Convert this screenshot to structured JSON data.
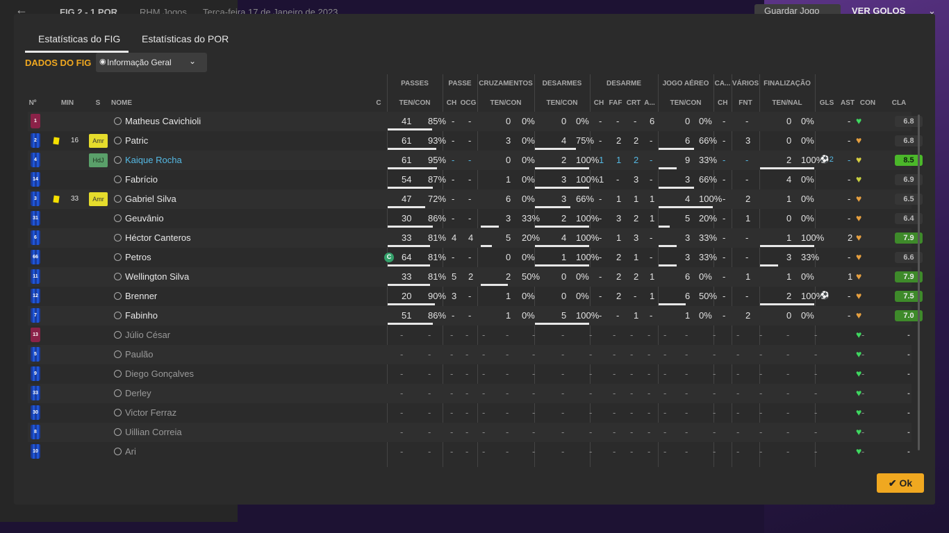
{
  "topbar": {
    "back": "←",
    "score": "FIG 2 - 1 POR",
    "manager": "RHM Jogos",
    "date": "Terça-feira 17 de Janeiro de 2023",
    "save": "Guardar Jogo",
    "goals": "VER GOLOS"
  },
  "tabs": [
    "Estatísticas do FIG",
    "Estatísticas do POR"
  ],
  "section_title": "DADOS DO FIG",
  "view_dropdown": "Informação Geral",
  "group_headers": [
    "PASSES",
    "PASSE",
    "CRUZAMENTOS",
    "DESARMES",
    "DESARME",
    "JOGO AÉREO",
    "CA...",
    "VÁRIOS",
    "FINALIZAÇÃO"
  ],
  "column_headers": [
    "Nº",
    "MIN",
    "S",
    "NOME",
    "C",
    "TEN/CON",
    "CH",
    "OCG",
    "TEN/CON",
    "TEN/CON",
    "CH",
    "FAF",
    "CRT",
    "A...",
    "TEN/CON",
    "CH",
    "FNT",
    "TEN/NAL",
    "GLS",
    "AST",
    "CON",
    "CLA"
  ],
  "players": [
    {
      "num": "1",
      "gk": true,
      "min": "",
      "card": false,
      "pos": "",
      "name": "Matheus Cavichioli",
      "hl": false,
      "cap": false,
      "pass": [
        "41",
        "85%"
      ],
      "pass_pct": 85,
      "pch": "-",
      "pocg": "-",
      "cruz": [
        "0",
        "0%"
      ],
      "cruz_pct": 0,
      "des": [
        "0",
        "0%"
      ],
      "des_pct": 0,
      "dch": "-",
      "faf": "-",
      "crt": "-",
      "da": "6",
      "aer": [
        "0",
        "0%"
      ],
      "aer_pct": 0,
      "ca": "-",
      "fnt": "-",
      "fin": [
        "0",
        "0%"
      ],
      "fin_pct": 0,
      "gls": "",
      "ast": "-",
      "con": "#3fd860",
      "cla": "6.8",
      "cla_style": "n"
    },
    {
      "num": "2",
      "gk": false,
      "min": "16",
      "card": true,
      "pos": "Amr",
      "name": "Patric",
      "hl": false,
      "cap": false,
      "pass": [
        "61",
        "93%"
      ],
      "pass_pct": 93,
      "pch": "-",
      "pocg": "-",
      "cruz": [
        "3",
        "0%"
      ],
      "cruz_pct": 0,
      "des": [
        "4",
        "75%"
      ],
      "des_pct": 75,
      "dch": "-",
      "faf": "2",
      "crt": "2",
      "da": "-",
      "aer": [
        "6",
        "66%"
      ],
      "aer_pct": 66,
      "ca": "-",
      "fnt": "3",
      "fin": [
        "0",
        "0%"
      ],
      "fin_pct": 0,
      "gls": "",
      "ast": "-",
      "con": "#e6a040",
      "cla": "6.8",
      "cla_style": "n"
    },
    {
      "num": "4",
      "gk": false,
      "min": "",
      "card": false,
      "pos": "HdJ",
      "name": "Kaique Rocha",
      "hl": true,
      "cap": false,
      "pass": [
        "61",
        "95%"
      ],
      "pass_pct": 95,
      "pch": "-",
      "pocg": "-",
      "cruz": [
        "0",
        "0%"
      ],
      "cruz_pct": 0,
      "des": [
        "2",
        "100%"
      ],
      "des_pct": 100,
      "dch": "1",
      "faf": "1",
      "crt": "2",
      "da": "-",
      "aer": [
        "9",
        "33%"
      ],
      "aer_pct": 33,
      "ca": "-",
      "fnt": "-",
      "fin": [
        "2",
        "100%"
      ],
      "fin_pct": 100,
      "gls": "⚽2",
      "ast": "-",
      "con": "#d8d040",
      "cla": "8.5",
      "cla_style": "bg"
    },
    {
      "num": "14",
      "gk": false,
      "min": "",
      "card": false,
      "pos": "",
      "name": "Fabrício",
      "hl": false,
      "cap": false,
      "pass": [
        "54",
        "87%"
      ],
      "pass_pct": 87,
      "pch": "-",
      "pocg": "-",
      "cruz": [
        "1",
        "0%"
      ],
      "cruz_pct": 0,
      "des": [
        "3",
        "100%"
      ],
      "des_pct": 100,
      "dch": "1",
      "faf": "-",
      "crt": "3",
      "da": "-",
      "aer": [
        "3",
        "66%"
      ],
      "aer_pct": 66,
      "ca": "-",
      "fnt": "-",
      "fin": [
        "4",
        "0%"
      ],
      "fin_pct": 0,
      "gls": "",
      "ast": "-",
      "con": "#c8d040",
      "cla": "6.9",
      "cla_style": "n"
    },
    {
      "num": "3",
      "gk": false,
      "min": "33",
      "card": true,
      "pos": "Amr",
      "name": "Gabriel Silva",
      "hl": false,
      "cap": false,
      "pass": [
        "47",
        "72%"
      ],
      "pass_pct": 72,
      "pch": "-",
      "pocg": "-",
      "cruz": [
        "6",
        "0%"
      ],
      "cruz_pct": 0,
      "des": [
        "3",
        "66%"
      ],
      "des_pct": 66,
      "dch": "-",
      "faf": "1",
      "crt": "1",
      "da": "1",
      "aer": [
        "4",
        "100%"
      ],
      "aer_pct": 100,
      "ca": "-",
      "fnt": "2",
      "fin": [
        "1",
        "0%"
      ],
      "fin_pct": 0,
      "gls": "",
      "ast": "-",
      "con": "#e6a040",
      "cla": "6.5",
      "cla_style": "n"
    },
    {
      "num": "31",
      "gk": false,
      "min": "",
      "card": false,
      "pos": "",
      "name": "Geuvânio",
      "hl": false,
      "cap": false,
      "pass": [
        "30",
        "86%"
      ],
      "pass_pct": 86,
      "pch": "-",
      "pocg": "-",
      "cruz": [
        "3",
        "33%"
      ],
      "cruz_pct": 33,
      "des": [
        "2",
        "100%"
      ],
      "des_pct": 100,
      "dch": "-",
      "faf": "3",
      "crt": "2",
      "da": "1",
      "aer": [
        "5",
        "20%"
      ],
      "aer_pct": 20,
      "ca": "-",
      "fnt": "1",
      "fin": [
        "0",
        "0%"
      ],
      "fin_pct": 0,
      "gls": "",
      "ast": "-",
      "con": "#e6a040",
      "cla": "6.4",
      "cla_style": "n"
    },
    {
      "num": "6",
      "gk": false,
      "min": "",
      "card": false,
      "pos": "",
      "name": "Héctor Canteros",
      "hl": false,
      "cap": false,
      "pass": [
        "33",
        "81%"
      ],
      "pass_pct": 81,
      "pch": "4",
      "pocg": "4",
      "cruz": [
        "5",
        "20%"
      ],
      "cruz_pct": 20,
      "des": [
        "4",
        "100%"
      ],
      "des_pct": 100,
      "dch": "-",
      "faf": "1",
      "crt": "3",
      "da": "-",
      "aer": [
        "3",
        "33%"
      ],
      "aer_pct": 33,
      "ca": "-",
      "fnt": "-",
      "fin": [
        "1",
        "100%"
      ],
      "fin_pct": 100,
      "gls": "",
      "ast": "2",
      "con": "#e6a040",
      "cla": "7.9",
      "cla_style": "g"
    },
    {
      "num": "66",
      "gk": false,
      "min": "",
      "card": false,
      "pos": "",
      "name": "Petros",
      "hl": false,
      "cap": true,
      "pass": [
        "64",
        "81%"
      ],
      "pass_pct": 81,
      "pch": "-",
      "pocg": "-",
      "cruz": [
        "0",
        "0%"
      ],
      "cruz_pct": 0,
      "des": [
        "1",
        "100%"
      ],
      "des_pct": 100,
      "dch": "-",
      "faf": "2",
      "crt": "1",
      "da": "-",
      "aer": [
        "3",
        "33%"
      ],
      "aer_pct": 33,
      "ca": "-",
      "fnt": "-",
      "fin": [
        "3",
        "33%"
      ],
      "fin_pct": 33,
      "gls": "",
      "ast": "-",
      "con": "#e6a040",
      "cla": "6.6",
      "cla_style": "n"
    },
    {
      "num": "11",
      "gk": false,
      "min": "",
      "card": false,
      "pos": "",
      "name": "Wellington Silva",
      "hl": false,
      "cap": false,
      "pass": [
        "33",
        "81%"
      ],
      "pass_pct": 81,
      "pch": "5",
      "pocg": "2",
      "cruz": [
        "2",
        "50%"
      ],
      "cruz_pct": 50,
      "des": [
        "0",
        "0%"
      ],
      "des_pct": 0,
      "dch": "-",
      "faf": "2",
      "crt": "2",
      "da": "1",
      "aer": [
        "6",
        "0%"
      ],
      "aer_pct": 0,
      "ca": "-",
      "fnt": "1",
      "fin": [
        "1",
        "0%"
      ],
      "fin_pct": 0,
      "gls": "",
      "ast": "1",
      "con": "#e6a040",
      "cla": "7.9",
      "cla_style": "g"
    },
    {
      "num": "12",
      "gk": false,
      "min": "",
      "card": false,
      "pos": "",
      "name": "Brenner",
      "hl": false,
      "cap": false,
      "pass": [
        "20",
        "90%"
      ],
      "pass_pct": 90,
      "pch": "3",
      "pocg": "-",
      "cruz": [
        "1",
        "0%"
      ],
      "cruz_pct": 0,
      "des": [
        "0",
        "0%"
      ],
      "des_pct": 0,
      "dch": "-",
      "faf": "2",
      "crt": "-",
      "da": "1",
      "aer": [
        "6",
        "50%"
      ],
      "aer_pct": 50,
      "ca": "-",
      "fnt": "-",
      "fin": [
        "2",
        "100%"
      ],
      "fin_pct": 100,
      "gls": "⚽",
      "ast": "-",
      "con": "#e6a040",
      "cla": "7.5",
      "cla_style": "g"
    },
    {
      "num": "7",
      "gk": false,
      "min": "",
      "card": false,
      "pos": "",
      "name": "Fabinho",
      "hl": false,
      "cap": false,
      "pass": [
        "51",
        "86%"
      ],
      "pass_pct": 86,
      "pch": "-",
      "pocg": "-",
      "cruz": [
        "1",
        "0%"
      ],
      "cruz_pct": 0,
      "des": [
        "5",
        "100%"
      ],
      "des_pct": 100,
      "dch": "-",
      "faf": "-",
      "crt": "1",
      "da": "-",
      "aer": [
        "1",
        "0%"
      ],
      "aer_pct": 0,
      "ca": "-",
      "fnt": "2",
      "fin": [
        "0",
        "0%"
      ],
      "fin_pct": 0,
      "gls": "",
      "ast": "-",
      "con": "#e6a040",
      "cla": "7.0",
      "cla_style": "g"
    },
    {
      "num": "13",
      "gk": true,
      "bench": true,
      "name": "Júlio César"
    },
    {
      "num": "5",
      "gk": false,
      "bench": true,
      "name": "Paulão"
    },
    {
      "num": "9",
      "gk": false,
      "bench": true,
      "name": "Diego Gonçalves"
    },
    {
      "num": "33",
      "gk": false,
      "bench": true,
      "name": "Derley"
    },
    {
      "num": "30",
      "gk": false,
      "bench": true,
      "name": "Victor Ferraz"
    },
    {
      "num": "8",
      "gk": false,
      "bench": true,
      "name": "Uillian Correia"
    },
    {
      "num": "10",
      "gk": false,
      "bench": true,
      "name": "Ari"
    }
  ],
  "cap_label": "C",
  "ok_label": "Ok"
}
